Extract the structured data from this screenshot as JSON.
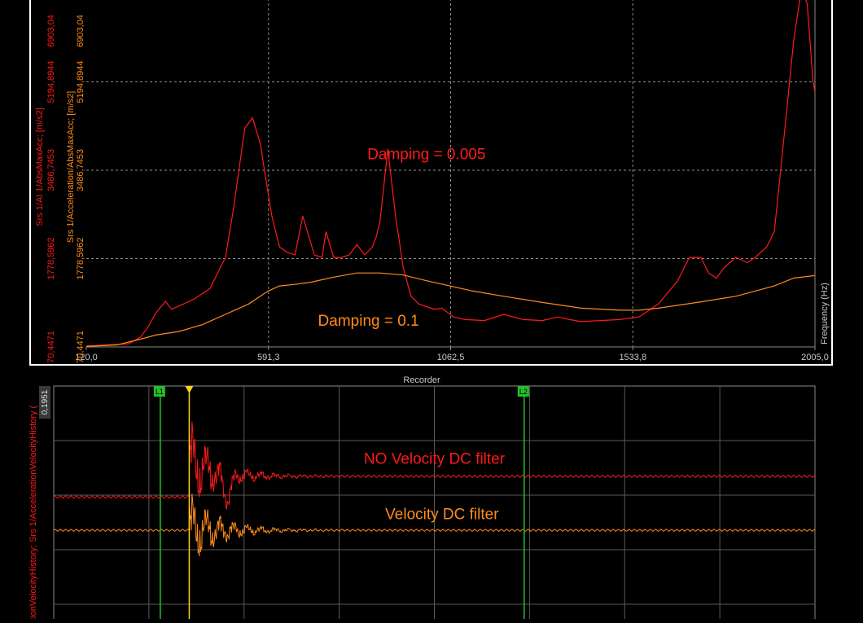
{
  "colors": {
    "background": "#000000",
    "frame": "#ffffff",
    "grid": "#8a8a8a",
    "red": "#ff1a1a",
    "orange": "#ff8c1a",
    "green": "#22c02a",
    "cursor_yellow": "#ffd21a",
    "tick_text": "#c8c8c8"
  },
  "chart_data": [
    {
      "type": "line",
      "title": "",
      "xlabel": "Frequency (Hz)",
      "ylabel_left_outer": "Srs 1/AI 1/AbsMaxAcc; [m/s2]",
      "ylabel_left_inner": "Srs 1/Acceleration/AbsMaxAcc; [m/s2]",
      "x_ticks": [
        {
          "value": 120.0,
          "label": "120,0"
        },
        {
          "value": 591.3,
          "label": "591,3"
        },
        {
          "value": 1062.5,
          "label": "1062,5"
        },
        {
          "value": 1533.8,
          "label": "1533,8"
        },
        {
          "value": 2005.0,
          "label": "2005,0"
        }
      ],
      "y_ticks": [
        {
          "value": 70.4471,
          "label": "70,4471"
        },
        {
          "value": 1778.5962,
          "label": "1778,5962"
        },
        {
          "value": 3486.7453,
          "label": "3486,7453"
        },
        {
          "value": 5194.8944,
          "label": "5194,8944"
        },
        {
          "value": 6903.04,
          "label": "6903,04"
        }
      ],
      "xlim": [
        120.0,
        2005.0
      ],
      "ylim": [
        70.4471,
        6903.04
      ],
      "grid": true,
      "annotations": [
        {
          "text": "Damping = 0.005",
          "x": 1000,
          "y": 3700,
          "color": "#ff1a1a"
        },
        {
          "text": "Damping = 0.1",
          "x": 850,
          "y": 480,
          "color": "#ff8c1a"
        }
      ],
      "series": [
        {
          "color": "#ff1a1a",
          "x": [
            120,
            230,
            260,
            280,
            300,
            325,
            340,
            360,
            400,
            440,
            480,
            500,
            530,
            550,
            570,
            590,
            600,
            620,
            640,
            660,
            680,
            710,
            730,
            740,
            760,
            780,
            800,
            820,
            840,
            860,
            870,
            880,
            900,
            920,
            940,
            960,
            980,
            1000,
            1020,
            1040,
            1070,
            1100,
            1150,
            1200,
            1250,
            1300,
            1340,
            1370,
            1400,
            1450,
            1500,
            1550,
            1600,
            1650,
            1680,
            1710,
            1730,
            1750,
            1770,
            1800,
            1830,
            1850,
            1880,
            1900,
            1930,
            1950,
            1970,
            1985,
            2000,
            2005
          ],
          "y": [
            90,
            130,
            260,
            460,
            730,
            950,
            800,
            860,
            1000,
            1200,
            1800,
            2700,
            4300,
            4500,
            4000,
            3050,
            2600,
            2000,
            1900,
            1850,
            2600,
            1850,
            1800,
            2300,
            1800,
            1800,
            1850,
            2050,
            1850,
            2000,
            2200,
            2500,
            3900,
            2600,
            1600,
            1050,
            900,
            850,
            800,
            820,
            650,
            600,
            580,
            700,
            600,
            580,
            650,
            600,
            560,
            580,
            600,
            650,
            900,
            1350,
            1800,
            1800,
            1500,
            1400,
            1600,
            1800,
            1700,
            1800,
            2000,
            2300,
            4500,
            6000,
            7000,
            6700,
            5200,
            5000
          ]
        },
        {
          "color": "#ff8c1a",
          "x": [
            120,
            200,
            260,
            300,
            360,
            420,
            480,
            540,
            590,
            620,
            660,
            700,
            760,
            820,
            880,
            940,
            1000,
            1060,
            1120,
            1200,
            1300,
            1400,
            1500,
            1550,
            1600,
            1700,
            1800,
            1900,
            1950,
            2005
          ],
          "y": [
            80,
            110,
            220,
            300,
            370,
            500,
            700,
            900,
            1150,
            1250,
            1280,
            1320,
            1420,
            1500,
            1500,
            1460,
            1350,
            1250,
            1150,
            1050,
            930,
            820,
            780,
            780,
            820,
            930,
            1050,
            1250,
            1400,
            1450
          ]
        }
      ]
    },
    {
      "type": "line",
      "title": "Recorder",
      "ylabel": "ationVelocityHistory; Srs 1/AccelerationVelocityHistory (",
      "y_ticks": [
        {
          "value": 0.1951,
          "label": "0,1951"
        }
      ],
      "xlim": [
        0,
        1000
      ],
      "ylim": [
        -0.12,
        0.1951
      ],
      "grid": true,
      "markers": [
        {
          "label": "L1",
          "x": 140,
          "color": "#22c02a"
        },
        {
          "label": "L2",
          "x": 618,
          "color": "#22c02a"
        }
      ],
      "cursor": {
        "x": 178,
        "color": "#ffd21a"
      },
      "annotations": [
        {
          "text": "NO Velocity DC filter",
          "x": 500,
          "y": 0.09,
          "color": "#ff1a1a"
        },
        {
          "text": "Velocity DC filter",
          "x": 510,
          "y": 0.015,
          "color": "#ff8c1a"
        }
      ],
      "series": [
        {
          "color": "#ff1a1a",
          "baseline_before": 0.045,
          "baseline_after": 0.073,
          "event_x": 178,
          "ripple": 0.0015,
          "settle": 0.04
        },
        {
          "color": "#ff8c1a",
          "baseline_before": 0.0,
          "baseline_after": 0.0,
          "event_x": 178,
          "ripple": 0.0012,
          "settle": 0.035
        }
      ]
    }
  ]
}
